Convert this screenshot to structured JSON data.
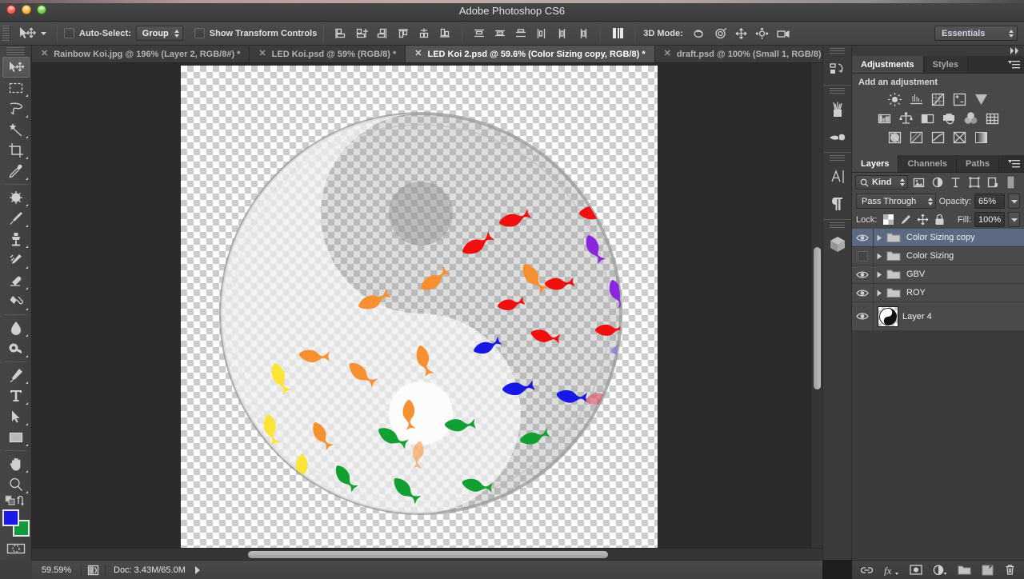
{
  "window": {
    "title": "Adobe Photoshop CS6",
    "traffic_lights": [
      "close-red",
      "minimize-yellow",
      "zoom-green"
    ]
  },
  "options_bar": {
    "tool": "move-tool",
    "auto_select_label": "Auto-Select:",
    "auto_select_checked": false,
    "auto_select_value": "Group",
    "show_transform_label": "Show Transform Controls",
    "show_transform_checked": false,
    "align_buttons": [
      "align-left-edges",
      "align-horizontal-centers",
      "align-right-edges",
      "align-top-edges",
      "align-vertical-centers",
      "align-bottom-edges"
    ],
    "distribute_buttons": [
      "distribute-top-edges",
      "distribute-vertical-centers",
      "distribute-bottom-edges",
      "distribute-left-edges",
      "distribute-horizontal-centers",
      "distribute-right-edges"
    ],
    "auto_align_button": "auto-align-layers",
    "mode_3d_label": "3D Mode:",
    "mode_3d_buttons": [
      "rotate-3d",
      "roll-3d",
      "pan-3d",
      "slide-3d",
      "scale-3d-camera"
    ],
    "workspace": "Essentials"
  },
  "tabs": [
    {
      "title": "Rainbow Koi.jpg @ 196% (Layer 2, RGB/8#) *",
      "active": false
    },
    {
      "title": "LED Koi.psd @ 59% (RGB/8) *",
      "active": false
    },
    {
      "title": "LED Koi 2.psd @ 59.6% (Color Sizing copy, RGB/8) *",
      "active": true
    },
    {
      "title": "draft.psd @ 100% (Small 1, RGB/8)",
      "active": false
    }
  ],
  "toolbar": {
    "tools": [
      {
        "name": "move-tool",
        "active": true
      },
      {
        "name": "rectangular-marquee-tool",
        "active": false
      },
      {
        "name": "lasso-tool",
        "active": false
      },
      {
        "name": "magic-wand-tool",
        "active": false
      },
      {
        "name": "crop-tool",
        "active": false
      },
      {
        "name": "eyedropper-tool",
        "active": false
      },
      {
        "name": "spot-healing-brush-tool",
        "active": false
      },
      {
        "name": "brush-tool",
        "active": false
      },
      {
        "name": "clone-stamp-tool",
        "active": false
      },
      {
        "name": "history-brush-tool",
        "active": false
      },
      {
        "name": "eraser-tool",
        "active": false
      },
      {
        "name": "gradient-tool",
        "active": false
      },
      {
        "name": "blur-tool",
        "active": false
      },
      {
        "name": "dodge-tool",
        "active": false
      },
      {
        "name": "pen-tool",
        "active": false
      },
      {
        "name": "horizontal-type-tool",
        "active": false
      },
      {
        "name": "path-selection-tool",
        "active": false
      },
      {
        "name": "rectangle-tool",
        "active": false
      },
      {
        "name": "hand-tool",
        "active": false
      },
      {
        "name": "zoom-tool",
        "active": false
      }
    ],
    "foreground_color": "#1a1ae8",
    "background_color": "#109c3c",
    "quick_mask_button": "edit-in-quick-mask-mode",
    "screen_mode_button": "change-screen-mode"
  },
  "icon_dock": {
    "items": [
      "history-icon",
      "brush-presets-icon",
      "tool-presets-icon",
      "character-icon",
      "paragraph-icon",
      "3d-icon"
    ]
  },
  "adjustments_panel": {
    "tabs": [
      {
        "label": "Adjustments",
        "active": true
      },
      {
        "label": "Styles",
        "active": false
      }
    ],
    "heading": "Add an adjustment",
    "buttons": [
      [
        "brightness-contrast-icon",
        "levels-icon",
        "curves-icon",
        "exposure-icon",
        "vibrance-icon"
      ],
      [
        "hue-saturation-icon",
        "color-balance-icon",
        "black-white-icon",
        "photo-filter-icon",
        "channel-mixer-icon",
        "color-lookup-icon"
      ],
      [
        "invert-icon",
        "posterize-icon",
        "threshold-icon",
        "selective-color-icon",
        "gradient-map-icon"
      ]
    ],
    "menu_icon": "panel-menu-icon"
  },
  "layers_panel": {
    "tabs": [
      {
        "label": "Layers",
        "active": true
      },
      {
        "label": "Channels",
        "active": false
      },
      {
        "label": "Paths",
        "active": false
      }
    ],
    "filter": {
      "kind_label": "Kind",
      "search_icon": "search-icon",
      "filter_icons": [
        "pixel-filter-icon",
        "adjustment-filter-icon",
        "type-filter-icon",
        "shape-filter-icon",
        "smart-object-filter-icon"
      ],
      "toggle_icon": "filter-toggle-icon"
    },
    "blend_mode": "Pass Through",
    "opacity_label": "Opacity:",
    "opacity_value": "65%",
    "lock_label": "Lock:",
    "lock_icons": [
      "lock-transparent-pixels-icon",
      "lock-image-pixels-icon",
      "lock-position-icon",
      "lock-all-icon"
    ],
    "fill_label": "Fill:",
    "fill_value": "100%",
    "layers": [
      {
        "name": "Color Sizing copy",
        "visible": true,
        "type": "group",
        "selected": true
      },
      {
        "name": "Color Sizing",
        "visible": false,
        "type": "group",
        "selected": false
      },
      {
        "name": "GBV",
        "visible": true,
        "type": "group",
        "selected": false
      },
      {
        "name": "ROY",
        "visible": true,
        "type": "group",
        "selected": false
      },
      {
        "name": "Layer 4",
        "visible": true,
        "type": "pixel",
        "selected": false,
        "thumbnail": "yin-yang"
      }
    ],
    "footer_buttons": [
      "link-layers-icon",
      "add-layer-style-icon",
      "add-layer-mask-icon",
      "new-fill-adjustment-icon",
      "new-group-icon",
      "new-layer-icon",
      "delete-layer-icon"
    ],
    "menu_icon": "panel-menu-icon"
  },
  "status_bar": {
    "zoom": "59.59%",
    "doc_info": "Doc: 3.43M/65.0M",
    "expand_icon": "expand-arrow-icon",
    "preview_icon": "preview-box-icon"
  },
  "canvas": {
    "artwork": "rainbow-koi-yin-yang",
    "transparent_background": true
  },
  "colors": {
    "selected_layer": "#5b6a82",
    "panel_bg": "#3b3b3b",
    "panel_section": "#484848",
    "canvas_bg": "#2b2b2b",
    "accent_text": "#ffffff"
  }
}
